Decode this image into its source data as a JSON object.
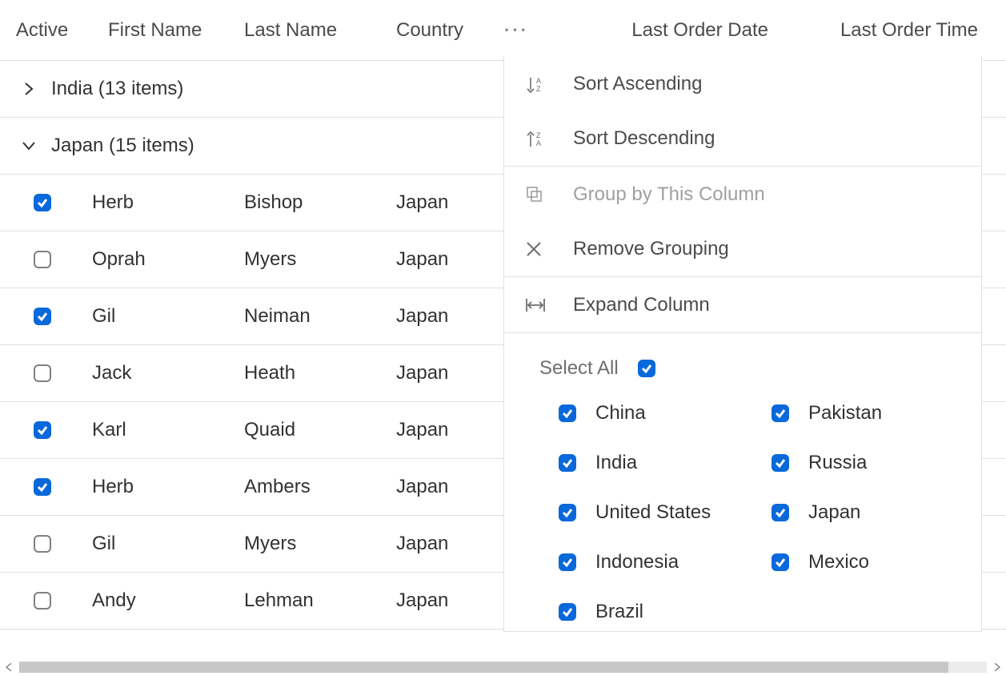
{
  "columns": {
    "active": "Active",
    "first": "First Name",
    "last": "Last Name",
    "country": "Country",
    "date": "Last Order Date",
    "time": "Last Order Time"
  },
  "groups": [
    {
      "label": "India (13 items)",
      "expanded": false
    },
    {
      "label": "Japan (15 items)",
      "expanded": true
    }
  ],
  "rows": [
    {
      "active": true,
      "first": "Herb",
      "last": "Bishop",
      "country": "Japan"
    },
    {
      "active": false,
      "first": "Oprah",
      "last": "Myers",
      "country": "Japan"
    },
    {
      "active": true,
      "first": "Gil",
      "last": "Neiman",
      "country": "Japan"
    },
    {
      "active": false,
      "first": "Jack",
      "last": "Heath",
      "country": "Japan"
    },
    {
      "active": true,
      "first": "Karl",
      "last": "Quaid",
      "country": "Japan"
    },
    {
      "active": true,
      "first": "Herb",
      "last": "Ambers",
      "country": "Japan"
    },
    {
      "active": false,
      "first": "Gil",
      "last": "Myers",
      "country": "Japan"
    },
    {
      "active": false,
      "first": "Andy",
      "last": "Lehman",
      "country": "Japan"
    }
  ],
  "menu": {
    "sort_asc": "Sort Ascending",
    "sort_desc": "Sort Descending",
    "group_by": "Group by This Column",
    "remove_grouping": "Remove Grouping",
    "expand_col": "Expand Column"
  },
  "filter": {
    "select_all_label": "Select All",
    "select_all_checked": true,
    "options_left": [
      {
        "label": "China",
        "checked": true
      },
      {
        "label": "India",
        "checked": true
      },
      {
        "label": "United States",
        "checked": true
      },
      {
        "label": "Indonesia",
        "checked": true
      },
      {
        "label": "Brazil",
        "checked": true
      }
    ],
    "options_right": [
      {
        "label": "Pakistan",
        "checked": true
      },
      {
        "label": "Russia",
        "checked": true
      },
      {
        "label": "Japan",
        "checked": true
      },
      {
        "label": "Mexico",
        "checked": true
      }
    ]
  }
}
